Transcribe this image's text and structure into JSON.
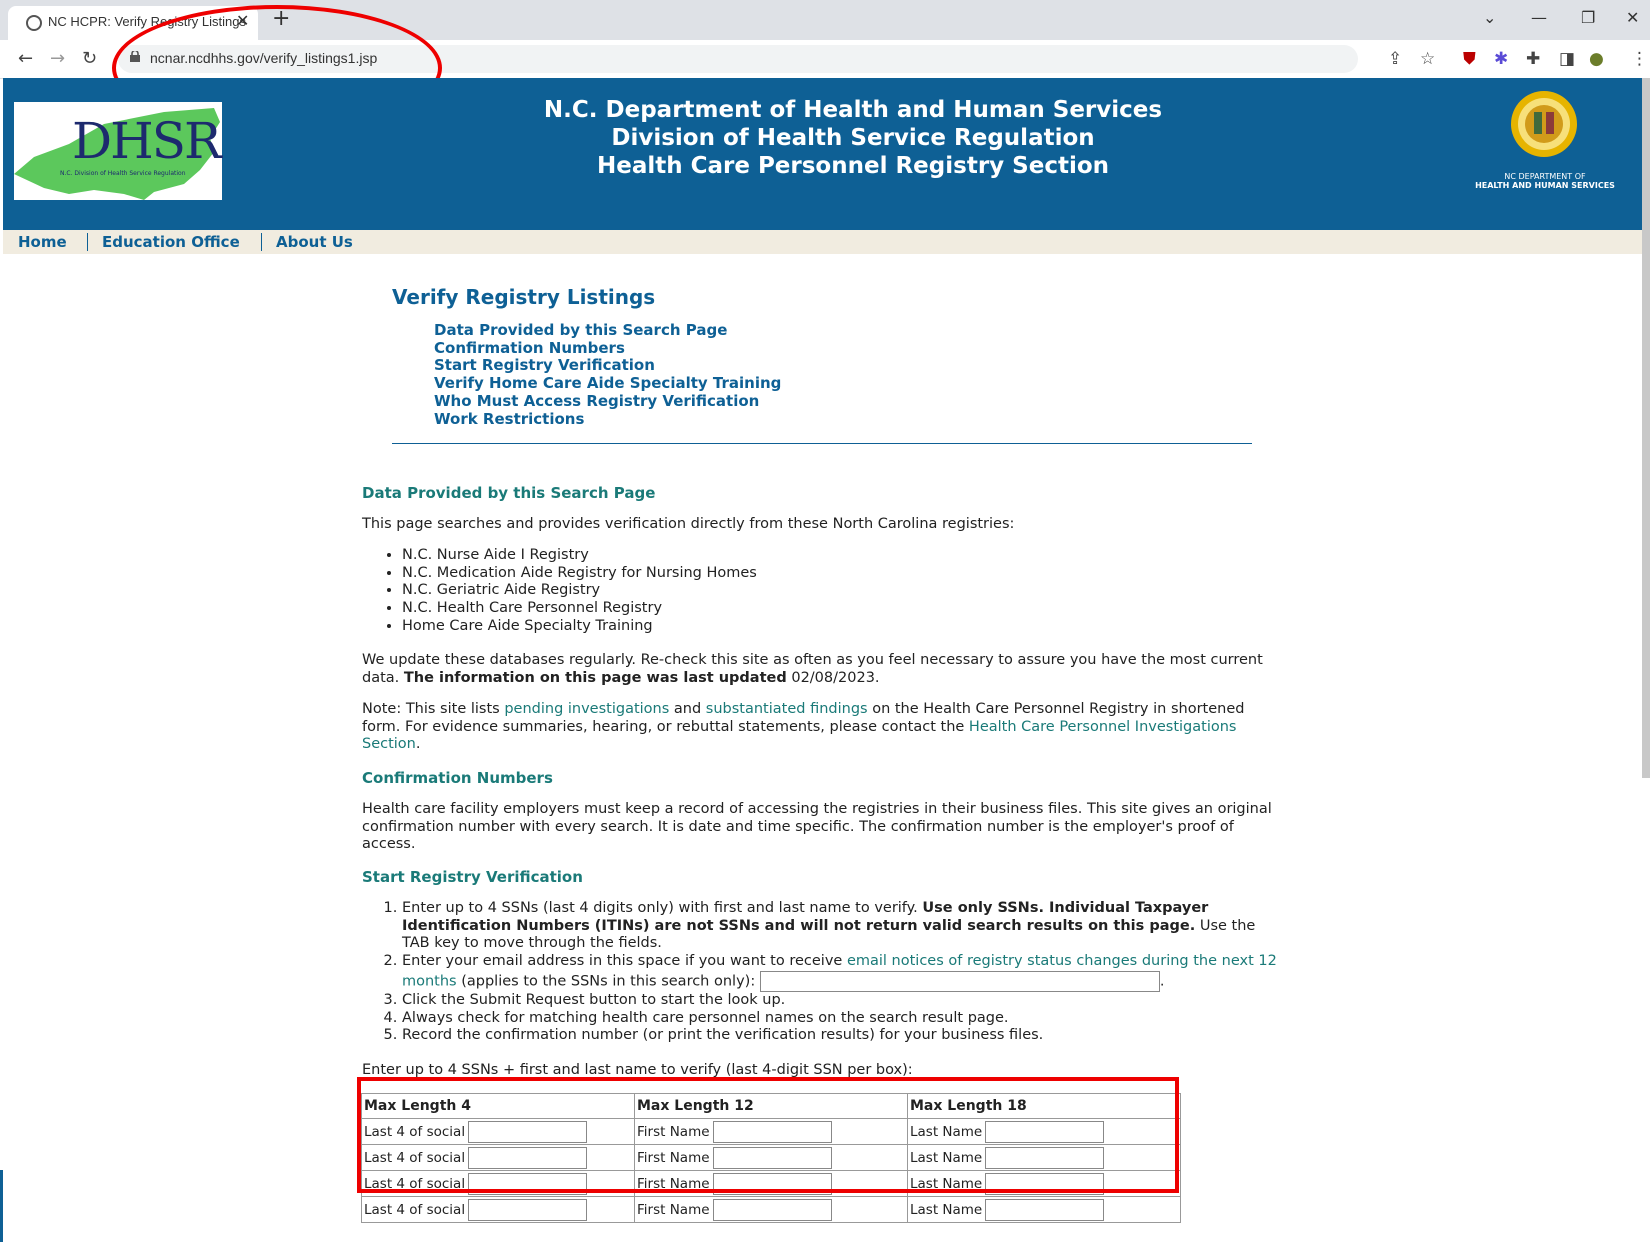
{
  "browser": {
    "tab_title": "NC HCPR: Verify Registry Listings",
    "url": "ncnar.ncdhhs.gov/verify_listings1.jsp"
  },
  "header": {
    "logo_text": "DHSR",
    "logo_subtext": "N.C. Division of Health Service Regulation",
    "title_lines": [
      "N.C. Department of Health and Human Services",
      "Division of Health Service Regulation",
      "Health Care Personnel Registry Section"
    ],
    "seal_caption_1": "NC DEPARTMENT OF",
    "seal_caption_2": "HEALTH AND HUMAN SERVICES"
  },
  "menu": [
    "Home",
    "Education Office",
    "About Us"
  ],
  "page_title": "Verify Registry Listings",
  "toc": [
    "Data Provided by this Search Page",
    "Confirmation Numbers",
    "Start Registry Verification",
    "Verify Home Care Aide Specialty Training",
    "Who Must Access Registry Verification",
    "Work Restrictions"
  ],
  "data_section": {
    "title": "Data Provided by this Search Page",
    "intro": "This page searches and provides verification directly from these North Carolina registries:",
    "registries": [
      "N.C. Nurse Aide I Registry",
      "N.C. Medication Aide Registry for Nursing Homes",
      "N.C. Geriatric Aide Registry",
      "N.C. Health Care Personnel Registry",
      "Home Care Aide Specialty Training"
    ],
    "update_text": "We update these databases regularly. Re-check this site as often as you feel necessary to assure you have the most current data.",
    "update_bold": "The information on this page was last updated",
    "update_date": "02/08/2023.",
    "note_1": "Note: This site lists",
    "note_link_1": "pending investigations",
    "note_2": "and",
    "note_link_2": "substantiated findings",
    "note_3": "on the Health Care Personnel Registry in shortened form. For evidence summaries, hearing, or rebuttal statements, please contact the",
    "note_link_3": "Health Care Personnel Investigations Section",
    "note_4": "."
  },
  "confirmation": {
    "title": "Confirmation Numbers",
    "text": "Health care facility employers must keep a record of accessing the registries in their business files. This site gives an original confirmation number with every search. It is date and time specific. The confirmation number is the employer's proof of access."
  },
  "start": {
    "title": "Start Registry Verification",
    "step1_a": "Enter up to 4 SSNs (last 4 digits only) with first and last name to verify.",
    "step1_bold": "Use only SSNs. Individual Taxpayer Identification Numbers (ITINs) are not SSNs and will not return valid search results on this page.",
    "step1_b": "Use the TAB key to move through the fields.",
    "step2_a": "Enter your email address in this space if you want to receive",
    "step2_link": "email notices of registry status changes during the next 12 months",
    "step2_b": "(applies to the SSNs in this search only):",
    "step3": "Click the Submit Request button to start the look up.",
    "step4": "Always check for matching health care personnel names on the search result page.",
    "step5": "Record the confirmation number (or print the verification results) for your business files.",
    "table_intro": "Enter up to 4 SSNs + first and last name to verify (last 4-digit SSN per box):"
  },
  "table": {
    "headers": [
      "Max Length 4",
      "Max Length 12",
      "Max Length 18"
    ],
    "labels": [
      "Last 4 of social",
      "First Name",
      "Last Name"
    ]
  }
}
